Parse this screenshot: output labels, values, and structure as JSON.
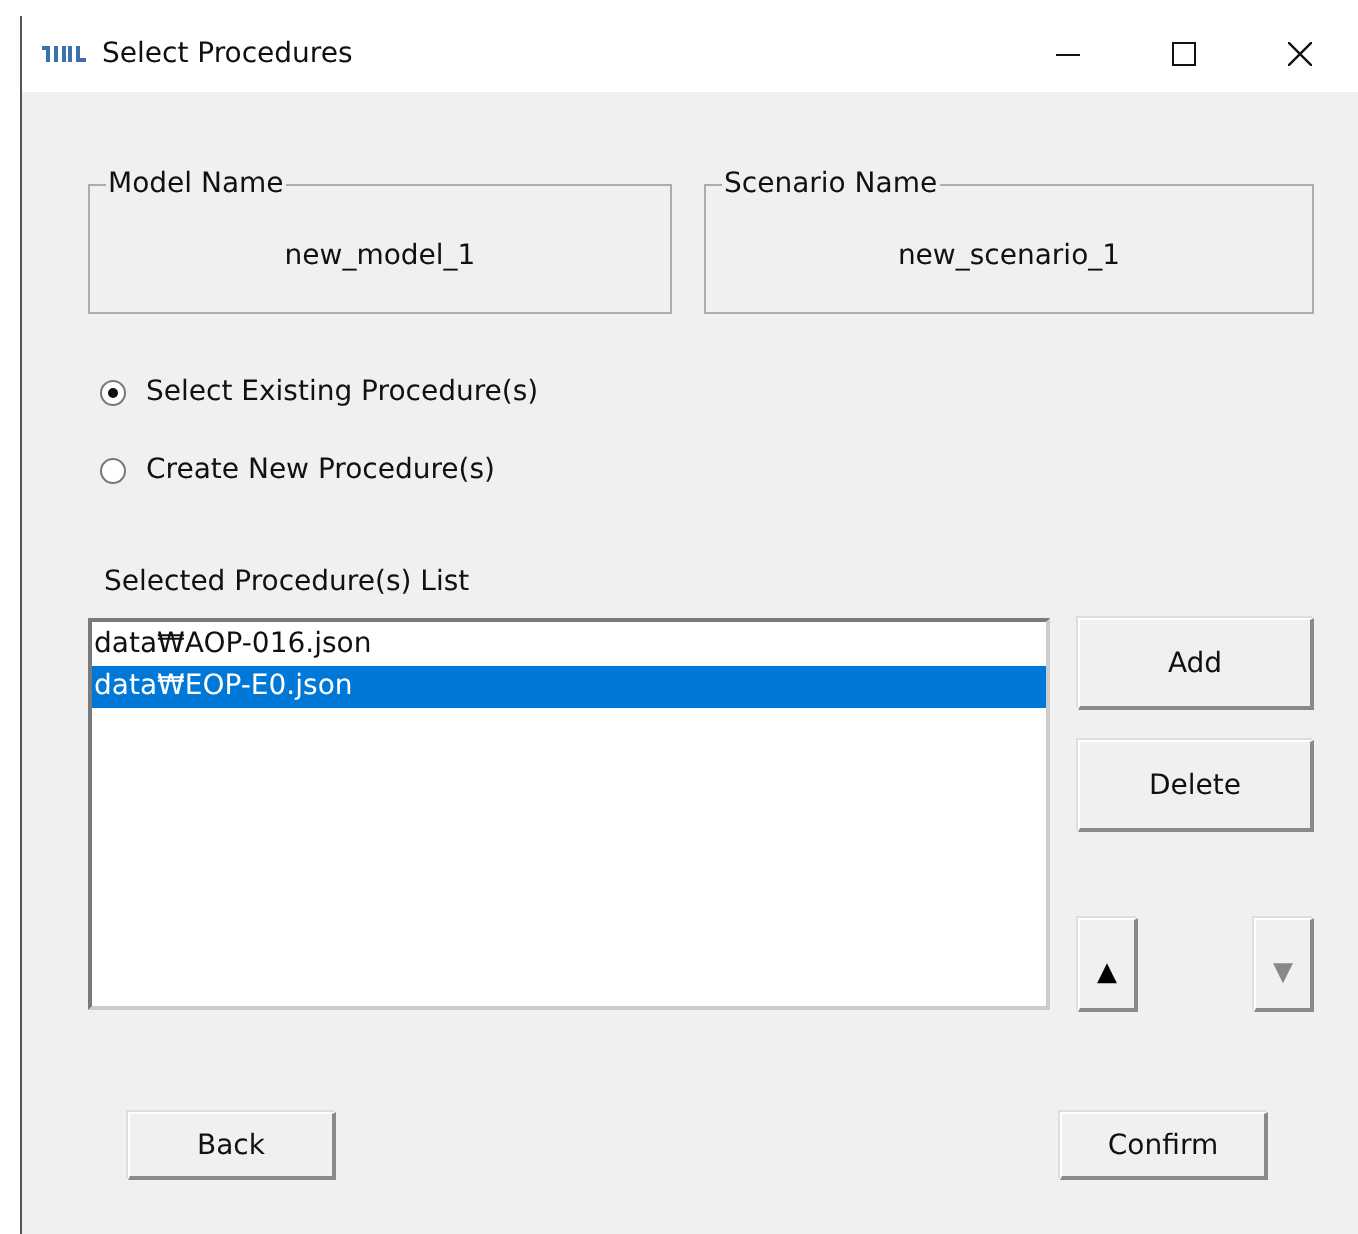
{
  "window": {
    "title": "Select Procedures"
  },
  "fields": [
    {
      "legend": "Model Name",
      "value": "new_model_1"
    },
    {
      "legend": "Scenario Name",
      "value": "new_scenario_1"
    }
  ],
  "mode_options": [
    {
      "label": "Select Existing Procedure(s)",
      "selected": true
    },
    {
      "label": "Create New Procedure(s)",
      "selected": false
    }
  ],
  "list_label": "Selected Procedure(s) List",
  "procedures": [
    {
      "label": "data₩AOP-016.json",
      "selected": false
    },
    {
      "label": "data₩EOP-E0.json",
      "selected": true
    }
  ],
  "side_buttons": [
    {
      "label": "Add"
    },
    {
      "label": "Delete"
    }
  ],
  "move_buttons": [
    {
      "label": "▲",
      "disabled": false
    },
    {
      "label": "▼",
      "disabled": true
    }
  ],
  "footer_buttons": [
    {
      "label": "Back"
    },
    {
      "label": "Confirm"
    }
  ]
}
